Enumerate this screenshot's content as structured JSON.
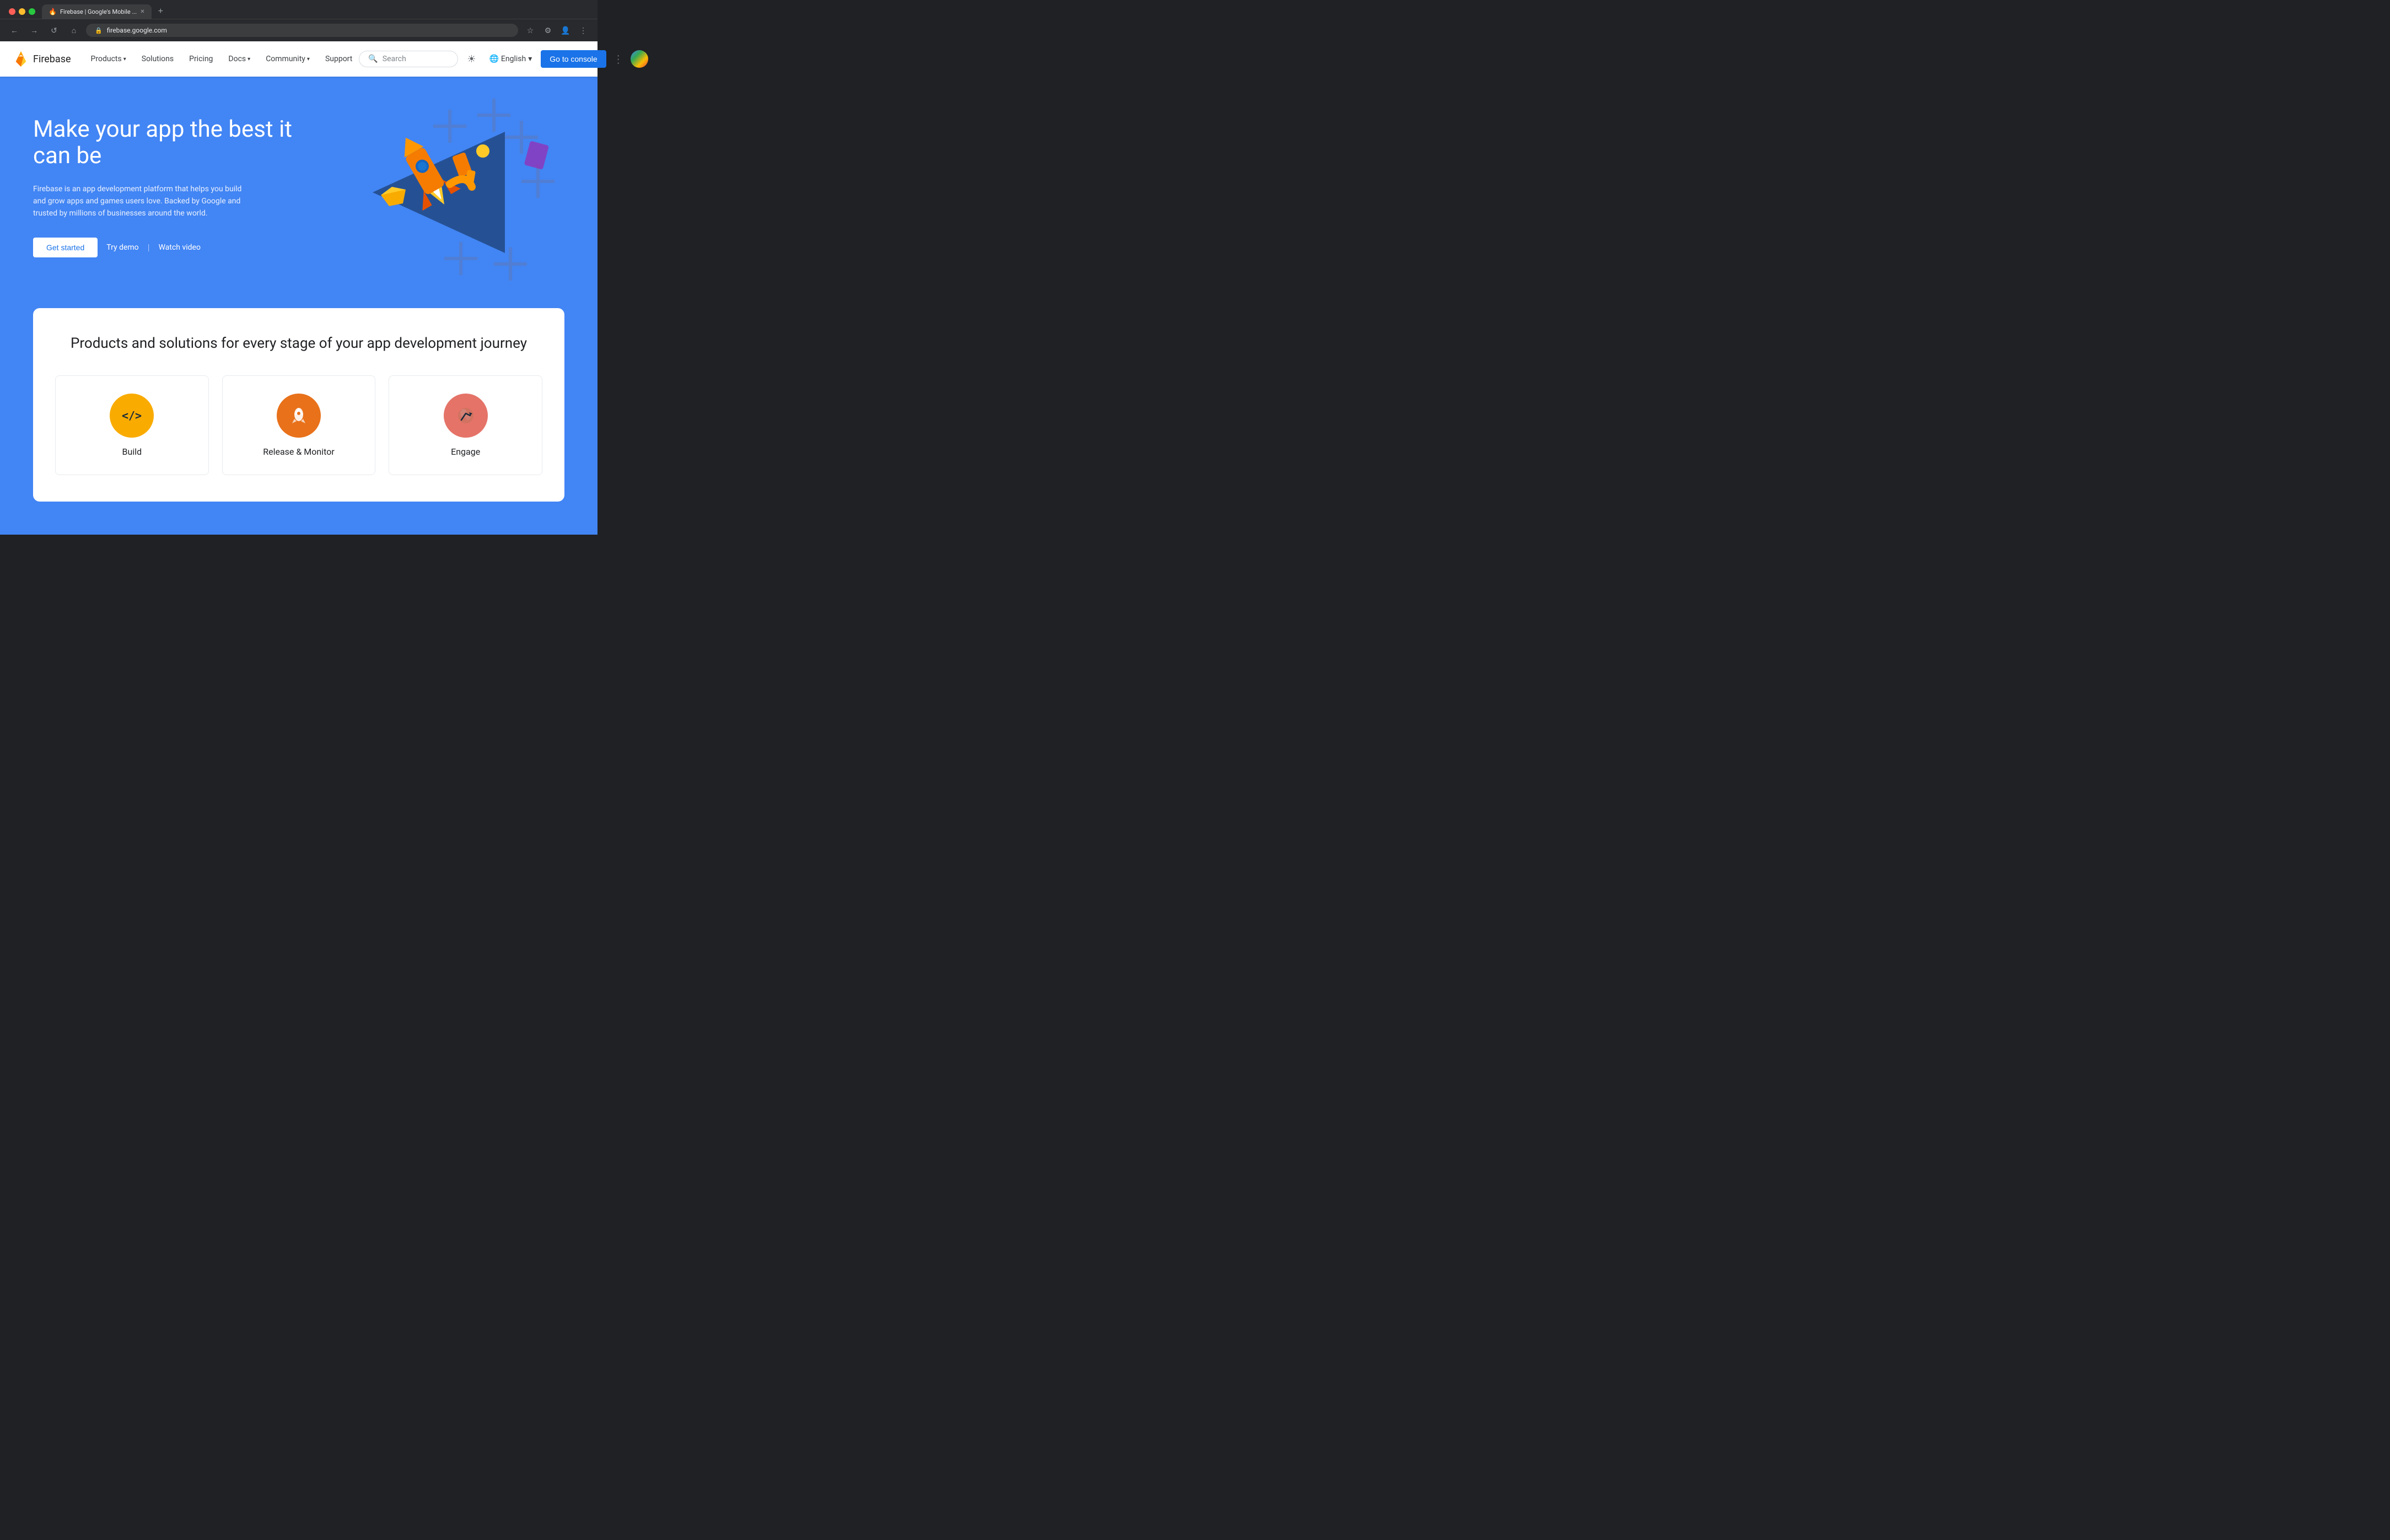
{
  "browser": {
    "tab_title": "Firebase | Google's Mobile ...",
    "tab_favicon": "🔥",
    "url": "firebase.google.com",
    "new_tab_label": "+",
    "nav_back": "←",
    "nav_forward": "→",
    "nav_reload": "↺",
    "nav_home": "⌂"
  },
  "nav": {
    "logo_text": "Firebase",
    "links": [
      {
        "label": "Products",
        "has_dropdown": true
      },
      {
        "label": "Solutions",
        "has_dropdown": false
      },
      {
        "label": "Pricing",
        "has_dropdown": false
      },
      {
        "label": "Docs",
        "has_dropdown": true
      },
      {
        "label": "Community",
        "has_dropdown": true
      },
      {
        "label": "Support",
        "has_dropdown": false
      }
    ],
    "search_placeholder": "Search",
    "language": "English",
    "console_btn": "Go to console"
  },
  "hero": {
    "title": "Make your app the best it can be",
    "description": "Firebase is an app development platform that helps you build and grow apps and games users love. Backed by Google and trusted by millions of businesses around the world.",
    "btn_get_started": "Get started",
    "btn_try_demo": "Try demo",
    "btn_watch_video": "Watch video"
  },
  "products": {
    "section_title": "Products and solutions for every stage of your app development journey",
    "items": [
      {
        "label": "Build",
        "icon": "build-icon",
        "bg": "#f9ab00"
      },
      {
        "label": "Release & Monitor",
        "icon": "release-icon",
        "bg": "#e8711a"
      },
      {
        "label": "Engage",
        "icon": "engage-icon",
        "bg": "#e57368"
      }
    ]
  },
  "colors": {
    "hero_bg": "#4285f4",
    "console_btn": "#1a73e8",
    "nav_bg": "#ffffff"
  }
}
